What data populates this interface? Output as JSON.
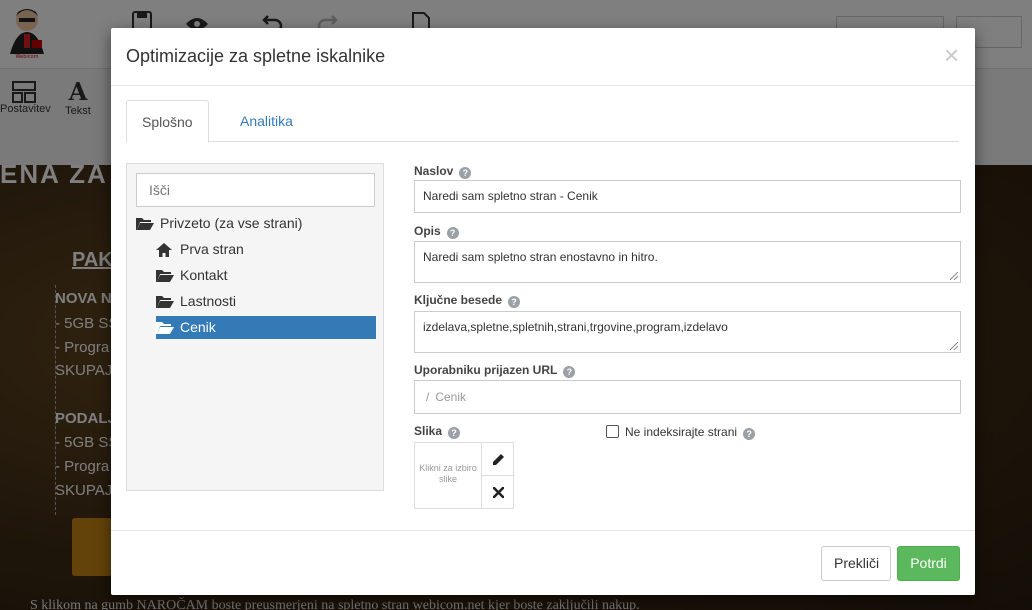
{
  "background": {
    "ribbon": [
      {
        "label": "Postavitev",
        "icon": "layout-icon"
      },
      {
        "label": "Tekst",
        "icon": "text-icon"
      }
    ],
    "canvas_texts": {
      "heading_partial": "ENA ZA",
      "pak": "PAK",
      "nova": "NOVA N",
      "line1": "- 5GB SS",
      "line2": "- Progra",
      "skupaj1": "SKUPAJ",
      "podalj": "PODALJ",
      "line3": "- 5GB SS",
      "line4": "- Progra",
      "skupaj2": "SKUPAJ"
    },
    "footer_text": "S klikom na gumb NAROČAM boste preusmerjeni na spletno stran webicom.net kjer boste zaključili nakup."
  },
  "modal": {
    "title": "Optimizacije za spletne iskalnike",
    "close_symbol": "×",
    "tabs": [
      {
        "label": "Splošno",
        "active": true
      },
      {
        "label": "Analitika",
        "active": false
      }
    ],
    "tree": {
      "search_placeholder": "Išči",
      "root": {
        "label": "Privzeto (za vse strani)",
        "icon": "folder-open-icon"
      },
      "items": [
        {
          "label": "Prva stran",
          "icon": "home-icon",
          "selected": false
        },
        {
          "label": "Kontakt",
          "icon": "folder-open-icon",
          "selected": false
        },
        {
          "label": "Lastnosti",
          "icon": "folder-open-icon",
          "selected": false
        },
        {
          "label": "Cenik",
          "icon": "folder-open-icon",
          "selected": true
        }
      ]
    },
    "form": {
      "title_label": "Naslov",
      "title_value": "Naredi sam spletno stran - Cenik",
      "description_label": "Opis",
      "description_value": "Naredi sam spletno stran enostavno in hitro.",
      "keywords_label": "Ključne besede",
      "keywords_value": "izdelava,spletne,spletnih,strani,trgovine,program,izdelavo",
      "url_label": "Uporabniku prijazen URL",
      "url_prefix": "/",
      "url_value": "Cenik",
      "image_label": "Slika",
      "image_placeholder": "Klikni za izbiro slike",
      "noindex_label": "Ne indeksirajte strani",
      "noindex_checked": false
    },
    "footer": {
      "cancel_label": "Prekliči",
      "ok_label": "Potrdi"
    }
  },
  "colors": {
    "primary": "#337ab7",
    "success": "#5cb85c",
    "overlay": "rgba(0,0,0,0.5)"
  }
}
